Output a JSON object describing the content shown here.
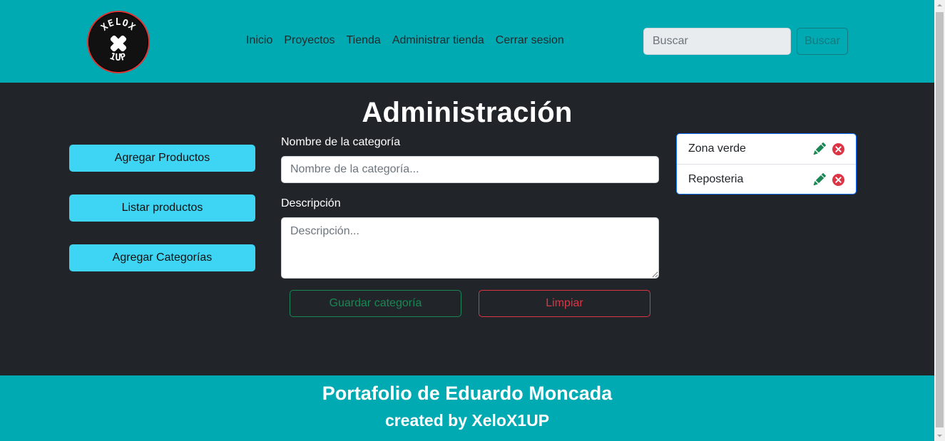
{
  "header": {
    "logo_text_top": "XELOX",
    "logo_text_bottom": "1UP",
    "nav": [
      "Inicio",
      "Proyectos",
      "Tienda",
      "Administrar tienda",
      "Cerrar sesion"
    ],
    "search_placeholder": "Buscar",
    "search_button": "Buscar"
  },
  "main": {
    "title": "Administración",
    "side_buttons": [
      "Agregar Productos",
      "Listar productos",
      "Agregar Categorías"
    ],
    "form": {
      "name_label": "Nombre de la categoría",
      "name_placeholder": "Nombre de la categoría...",
      "desc_label": "Descripción",
      "desc_placeholder": "Descripción...",
      "save_button": "Guardar categoría",
      "clear_button": "Limpiar"
    },
    "categories": [
      "Zona verde",
      "Reposteria"
    ],
    "icons": {
      "edit": "pencil-icon",
      "delete": "x-circle-icon"
    }
  },
  "footer": {
    "title": "Portafolio de Eduardo Moncada",
    "subtitle": "created by XeloX1UP"
  },
  "colors": {
    "primary": "#00aab3",
    "dark": "#212529",
    "info": "#3dd5f3",
    "success": "#198754",
    "danger": "#dc3545"
  }
}
